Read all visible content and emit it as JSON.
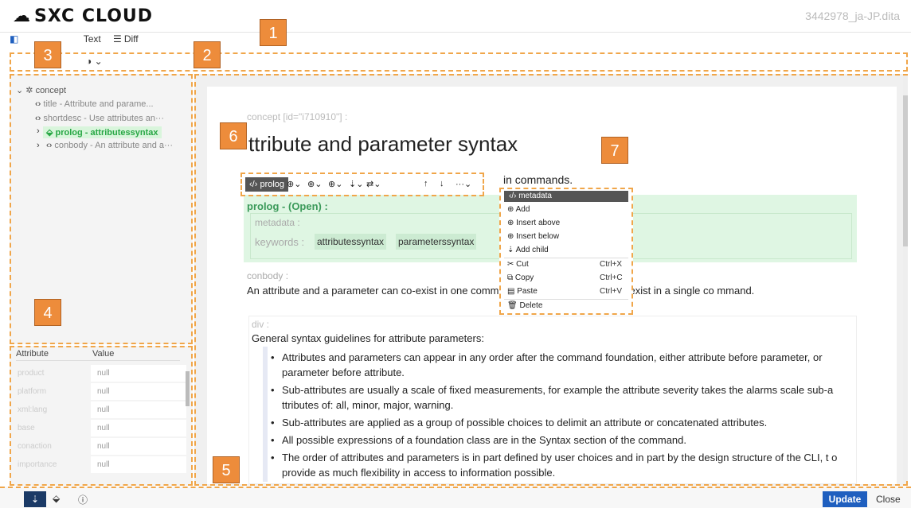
{
  "header": {
    "logo_text": "SXC CLOUD",
    "filename": "3442978_ja-JP.dita"
  },
  "tabs": [
    {
      "label": "Text",
      "icon": "text-icon"
    },
    {
      "label": "Diff",
      "icon": "diff-icon"
    }
  ],
  "toolbar": {
    "theme_icon": "◑ ⌄"
  },
  "tree": {
    "root": "concept",
    "items": [
      "title - Attribute and parame...",
      "shortdesc - Use attributes an···",
      "prolog - attributessyntax",
      "conbody - An attribute and a···"
    ]
  },
  "attributes": {
    "headers": [
      "Attribute",
      "Value"
    ],
    "rows": [
      {
        "name": "product",
        "value": "null"
      },
      {
        "name": "platform",
        "value": "null"
      },
      {
        "name": "xml:lang",
        "value": "null"
      },
      {
        "name": "base",
        "value": "null"
      },
      {
        "name": "conaction",
        "value": "null"
      },
      {
        "name": "importance",
        "value": "null"
      }
    ]
  },
  "editor": {
    "concept_label": "concept [id=\"i710910\"] :",
    "title": "ttribute and parameter syntax",
    "shortdesc_tail": "in commands.",
    "prolog_label": "prolog - (Open) :",
    "metadata_label": "metadata :",
    "keywords_label": "keywords :",
    "keywords": [
      "attributessyntax",
      "parameterssyntax"
    ],
    "conbody_label": "conbody :",
    "conbody_text": "An attribute and a parameter can co-exist in one comm                    multiple parameters can co-exist in a single co mmand.",
    "div_label": "div :",
    "div_text": "General syntax guidelines for attribute parameters:",
    "bullets": [
      "Attributes and parameters can appear in any order after the command foundation, either attribute before parameter, or parameter before attribute.",
      "Sub-attributes are usually a scale of fixed measurements, for example the attribute severity takes the alarms scale sub-a ttributes of: all, minor, major, warning.",
      "Sub-attributes are applied as a group of possible choices to delimit an attribute or concatenated attributes.",
      "All possible expressions of a foundation class are in the Syntax section of the command.",
      "The order of attributes and parameters is in part defined by user choices and in part by the design structure of the CLI, t o provide as much flexibility in access to information possible."
    ]
  },
  "element_toolbar": {
    "chip": "prolog"
  },
  "context_menu": {
    "title": "metadata",
    "items": [
      {
        "label": "Add",
        "shortcut": ""
      },
      {
        "label": "Insert above",
        "shortcut": ""
      },
      {
        "label": "Insert below",
        "shortcut": ""
      },
      {
        "label": "Add child",
        "shortcut": ""
      },
      {
        "label": "Cut",
        "shortcut": "Ctrl+X"
      },
      {
        "label": "Copy",
        "shortcut": "Ctrl+C"
      },
      {
        "label": "Paste",
        "shortcut": "Ctrl+V"
      },
      {
        "label": "Delete",
        "shortcut": ""
      }
    ]
  },
  "bottom": {
    "update_label": "Update",
    "close_label": "Close"
  },
  "callouts": [
    "1",
    "2",
    "3",
    "4",
    "5",
    "6",
    "7"
  ]
}
